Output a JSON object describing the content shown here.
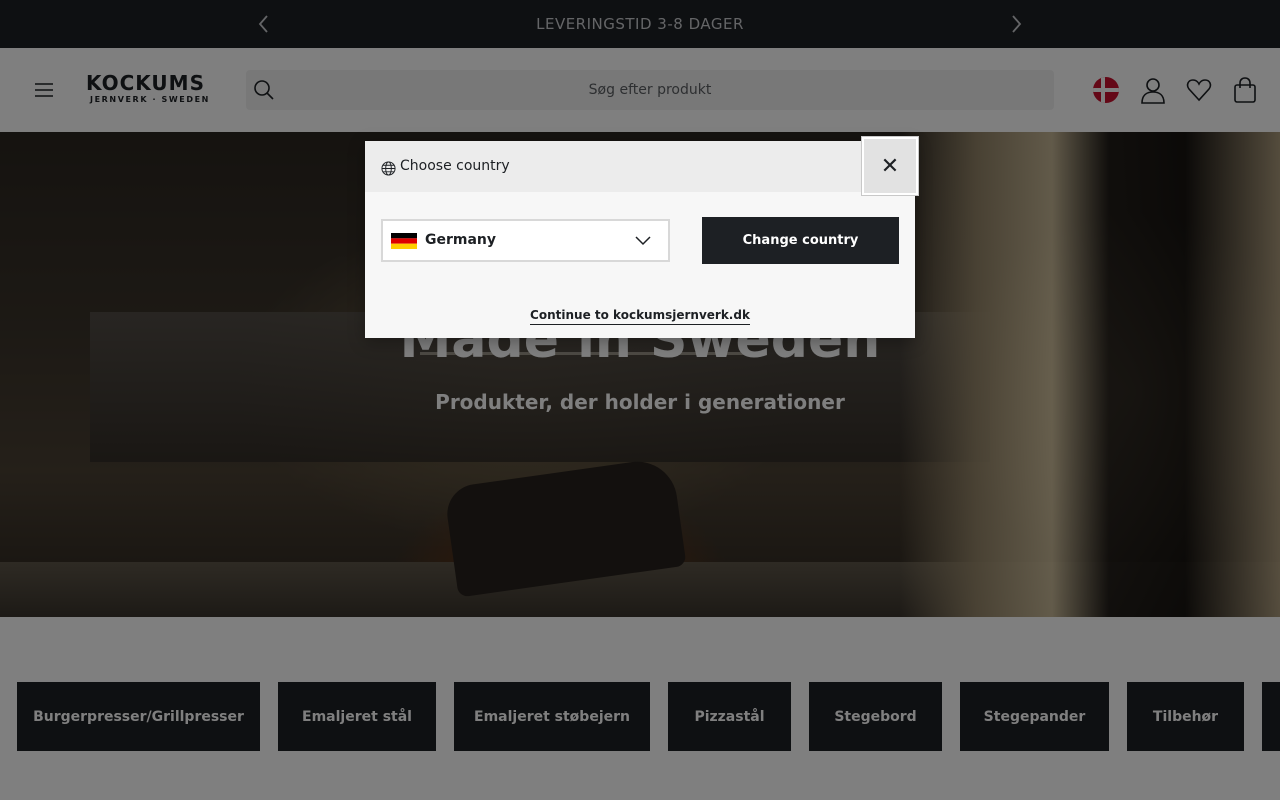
{
  "announcement": {
    "text": "LEVERINGSTID 3-8 DAGER",
    "prev_icon": "chevron-left-icon",
    "next_icon": "chevron-right-icon"
  },
  "header": {
    "logo_main": "KOCKUMS",
    "logo_sub": "JERNVERK · SWEDEN",
    "search_placeholder": "Søg efter produkt",
    "icons": [
      "menu-icon",
      "search-icon",
      "denmark-flag-icon",
      "user-icon",
      "heart-icon",
      "bag-icon"
    ]
  },
  "hero": {
    "title": "Made in Sweden",
    "subtitle": "Produkter, der holder i generationer"
  },
  "categories": [
    "Burgerpresser/Grillpresser",
    "Emaljeret stål",
    "Emaljeret støbejern",
    "Pizzastål",
    "Stegebord",
    "Stegepander",
    "Tilbehør"
  ],
  "modal": {
    "title": "Choose country",
    "selected_country": "Germany",
    "change_button": "Change country",
    "continue_link": "Continue to kockumsjernverk.dk",
    "close_icon": "close-icon"
  },
  "colors": {
    "dark": "#1d2024",
    "overlay": "rgba(0,0,0,0.5)"
  }
}
